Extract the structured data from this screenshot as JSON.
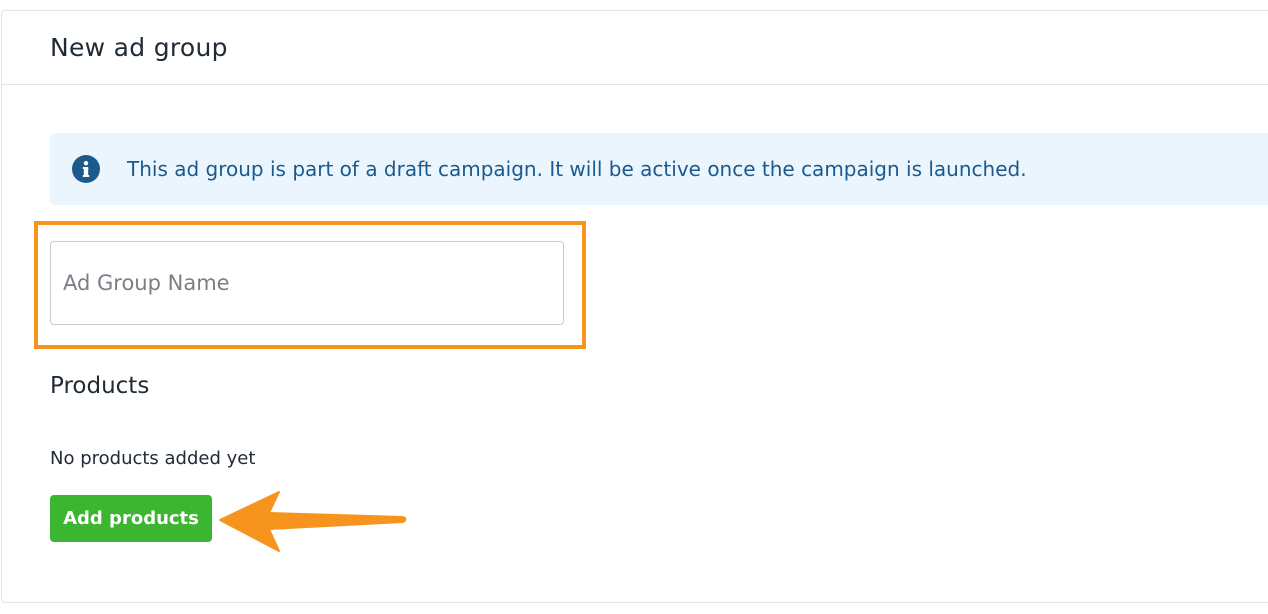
{
  "card": {
    "title": "New ad group"
  },
  "banner": {
    "icon": "info-icon",
    "message": "This ad group is part of a draft campaign. It will be active once the campaign is launched.",
    "background": "#ebf5fd",
    "text_color": "#1c5a8e"
  },
  "ad_group_name": {
    "placeholder": "Ad Group Name",
    "value": ""
  },
  "products": {
    "title": "Products",
    "empty_message": "No products added yet",
    "add_button_label": "Add products"
  },
  "annotations": {
    "highlight_color": "#f7941e",
    "arrow_color": "#f7941e"
  },
  "colors": {
    "primary_button": "#3cb531",
    "border": "#e1e3e5"
  }
}
